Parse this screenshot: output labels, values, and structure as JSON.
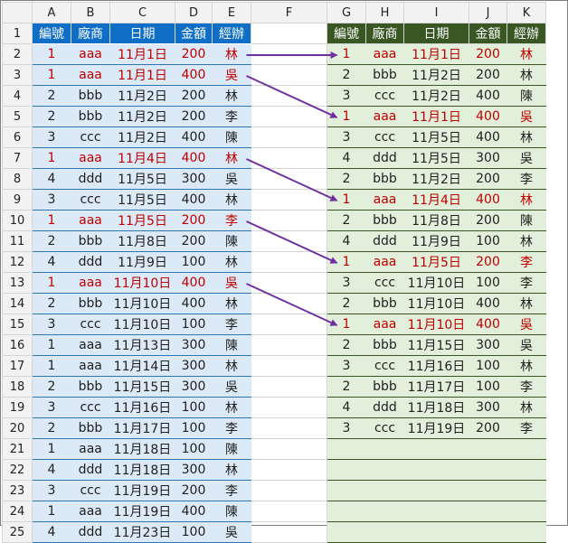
{
  "columns": [
    "A",
    "B",
    "C",
    "D",
    "E",
    "F",
    "G",
    "H",
    "I",
    "J",
    "K"
  ],
  "left_header": [
    "編號",
    "廠商",
    "日期",
    "金額",
    "經辦"
  ],
  "right_header": [
    "編號",
    "廠商",
    "日期",
    "金額",
    "經辦"
  ],
  "left_rows": [
    {
      "r": "2",
      "v": [
        "1",
        "aaa",
        "11月1日",
        "200",
        "林"
      ],
      "hl": true
    },
    {
      "r": "3",
      "v": [
        "1",
        "aaa",
        "11月1日",
        "400",
        "吳"
      ],
      "hl": true
    },
    {
      "r": "4",
      "v": [
        "2",
        "bbb",
        "11月2日",
        "200",
        "林"
      ],
      "hl": false
    },
    {
      "r": "5",
      "v": [
        "2",
        "bbb",
        "11月2日",
        "200",
        "李"
      ],
      "hl": false
    },
    {
      "r": "6",
      "v": [
        "3",
        "ccc",
        "11月2日",
        "400",
        "陳"
      ],
      "hl": false
    },
    {
      "r": "7",
      "v": [
        "1",
        "aaa",
        "11月4日",
        "400",
        "林"
      ],
      "hl": true
    },
    {
      "r": "8",
      "v": [
        "4",
        "ddd",
        "11月5日",
        "300",
        "吳"
      ],
      "hl": false
    },
    {
      "r": "9",
      "v": [
        "3",
        "ccc",
        "11月5日",
        "400",
        "林"
      ],
      "hl": false
    },
    {
      "r": "10",
      "v": [
        "1",
        "aaa",
        "11月5日",
        "200",
        "李"
      ],
      "hl": true
    },
    {
      "r": "11",
      "v": [
        "2",
        "bbb",
        "11月8日",
        "200",
        "陳"
      ],
      "hl": false
    },
    {
      "r": "12",
      "v": [
        "4",
        "ddd",
        "11月9日",
        "100",
        "林"
      ],
      "hl": false
    },
    {
      "r": "13",
      "v": [
        "1",
        "aaa",
        "11月10日",
        "400",
        "吳"
      ],
      "hl": true
    },
    {
      "r": "14",
      "v": [
        "2",
        "bbb",
        "11月10日",
        "400",
        "林"
      ],
      "hl": false
    },
    {
      "r": "15",
      "v": [
        "3",
        "ccc",
        "11月10日",
        "100",
        "李"
      ],
      "hl": false
    },
    {
      "r": "16",
      "v": [
        "1",
        "aaa",
        "11月13日",
        "300",
        "陳"
      ],
      "hl": false
    },
    {
      "r": "17",
      "v": [
        "1",
        "aaa",
        "11月14日",
        "300",
        "林"
      ],
      "hl": false
    },
    {
      "r": "18",
      "v": [
        "2",
        "bbb",
        "11月15日",
        "300",
        "吳"
      ],
      "hl": false
    },
    {
      "r": "19",
      "v": [
        "3",
        "ccc",
        "11月16日",
        "100",
        "林"
      ],
      "hl": false
    },
    {
      "r": "20",
      "v": [
        "2",
        "bbb",
        "11月17日",
        "100",
        "李"
      ],
      "hl": false
    },
    {
      "r": "21",
      "v": [
        "1",
        "aaa",
        "11月18日",
        "100",
        "陳"
      ],
      "hl": false
    },
    {
      "r": "22",
      "v": [
        "4",
        "ddd",
        "11月18日",
        "300",
        "林"
      ],
      "hl": false
    },
    {
      "r": "23",
      "v": [
        "3",
        "ccc",
        "11月19日",
        "200",
        "李"
      ],
      "hl": false
    },
    {
      "r": "24",
      "v": [
        "1",
        "aaa",
        "11月19日",
        "400",
        "陳"
      ],
      "hl": false
    },
    {
      "r": "25",
      "v": [
        "4",
        "ddd",
        "11月23日",
        "100",
        "吳"
      ],
      "hl": false
    }
  ],
  "right_rows": [
    {
      "v": [
        "1",
        "aaa",
        "11月1日",
        "200",
        "林"
      ],
      "hl": true
    },
    {
      "v": [
        "2",
        "bbb",
        "11月2日",
        "200",
        "林"
      ],
      "hl": false
    },
    {
      "v": [
        "3",
        "ccc",
        "11月2日",
        "400",
        "陳"
      ],
      "hl": false
    },
    {
      "v": [
        "1",
        "aaa",
        "11月1日",
        "400",
        "吳"
      ],
      "hl": true
    },
    {
      "v": [
        "3",
        "ccc",
        "11月5日",
        "400",
        "林"
      ],
      "hl": false
    },
    {
      "v": [
        "4",
        "ddd",
        "11月5日",
        "300",
        "吳"
      ],
      "hl": false
    },
    {
      "v": [
        "2",
        "bbb",
        "11月2日",
        "200",
        "李"
      ],
      "hl": false
    },
    {
      "v": [
        "1",
        "aaa",
        "11月4日",
        "400",
        "林"
      ],
      "hl": true
    },
    {
      "v": [
        "2",
        "bbb",
        "11月8日",
        "200",
        "陳"
      ],
      "hl": false
    },
    {
      "v": [
        "4",
        "ddd",
        "11月9日",
        "100",
        "林"
      ],
      "hl": false
    },
    {
      "v": [
        "1",
        "aaa",
        "11月5日",
        "200",
        "李"
      ],
      "hl": true
    },
    {
      "v": [
        "3",
        "ccc",
        "11月10日",
        "100",
        "李"
      ],
      "hl": false
    },
    {
      "v": [
        "2",
        "bbb",
        "11月10日",
        "400",
        "林"
      ],
      "hl": false
    },
    {
      "v": [
        "1",
        "aaa",
        "11月10日",
        "400",
        "吳"
      ],
      "hl": true
    },
    {
      "v": [
        "2",
        "bbb",
        "11月15日",
        "300",
        "吳"
      ],
      "hl": false
    },
    {
      "v": [
        "3",
        "ccc",
        "11月16日",
        "100",
        "林"
      ],
      "hl": false
    },
    {
      "v": [
        "2",
        "bbb",
        "11月17日",
        "100",
        "李"
      ],
      "hl": false
    },
    {
      "v": [
        "4",
        "ddd",
        "11月18日",
        "300",
        "林"
      ],
      "hl": false
    },
    {
      "v": [
        "3",
        "ccc",
        "11月19日",
        "200",
        "李"
      ],
      "hl": false
    },
    {
      "v": [],
      "hl": false
    },
    {
      "v": [],
      "hl": false
    },
    {
      "v": [],
      "hl": false
    },
    {
      "v": [],
      "hl": false
    },
    {
      "v": [],
      "hl": false
    }
  ],
  "arrows": [
    {
      "from_row": "2",
      "to_row": "2"
    },
    {
      "from_row": "3",
      "to_row": "5"
    },
    {
      "from_row": "7",
      "to_row": "9"
    },
    {
      "from_row": "10",
      "to_row": "12"
    },
    {
      "from_row": "13",
      "to_row": "15"
    }
  ],
  "colors": {
    "left_fill": "#dce9f6",
    "left_header": "#0f6fc6",
    "right_fill": "#e2efda",
    "right_header": "#385723",
    "highlight_text": "#c00000",
    "arrow": "#7030a0"
  }
}
